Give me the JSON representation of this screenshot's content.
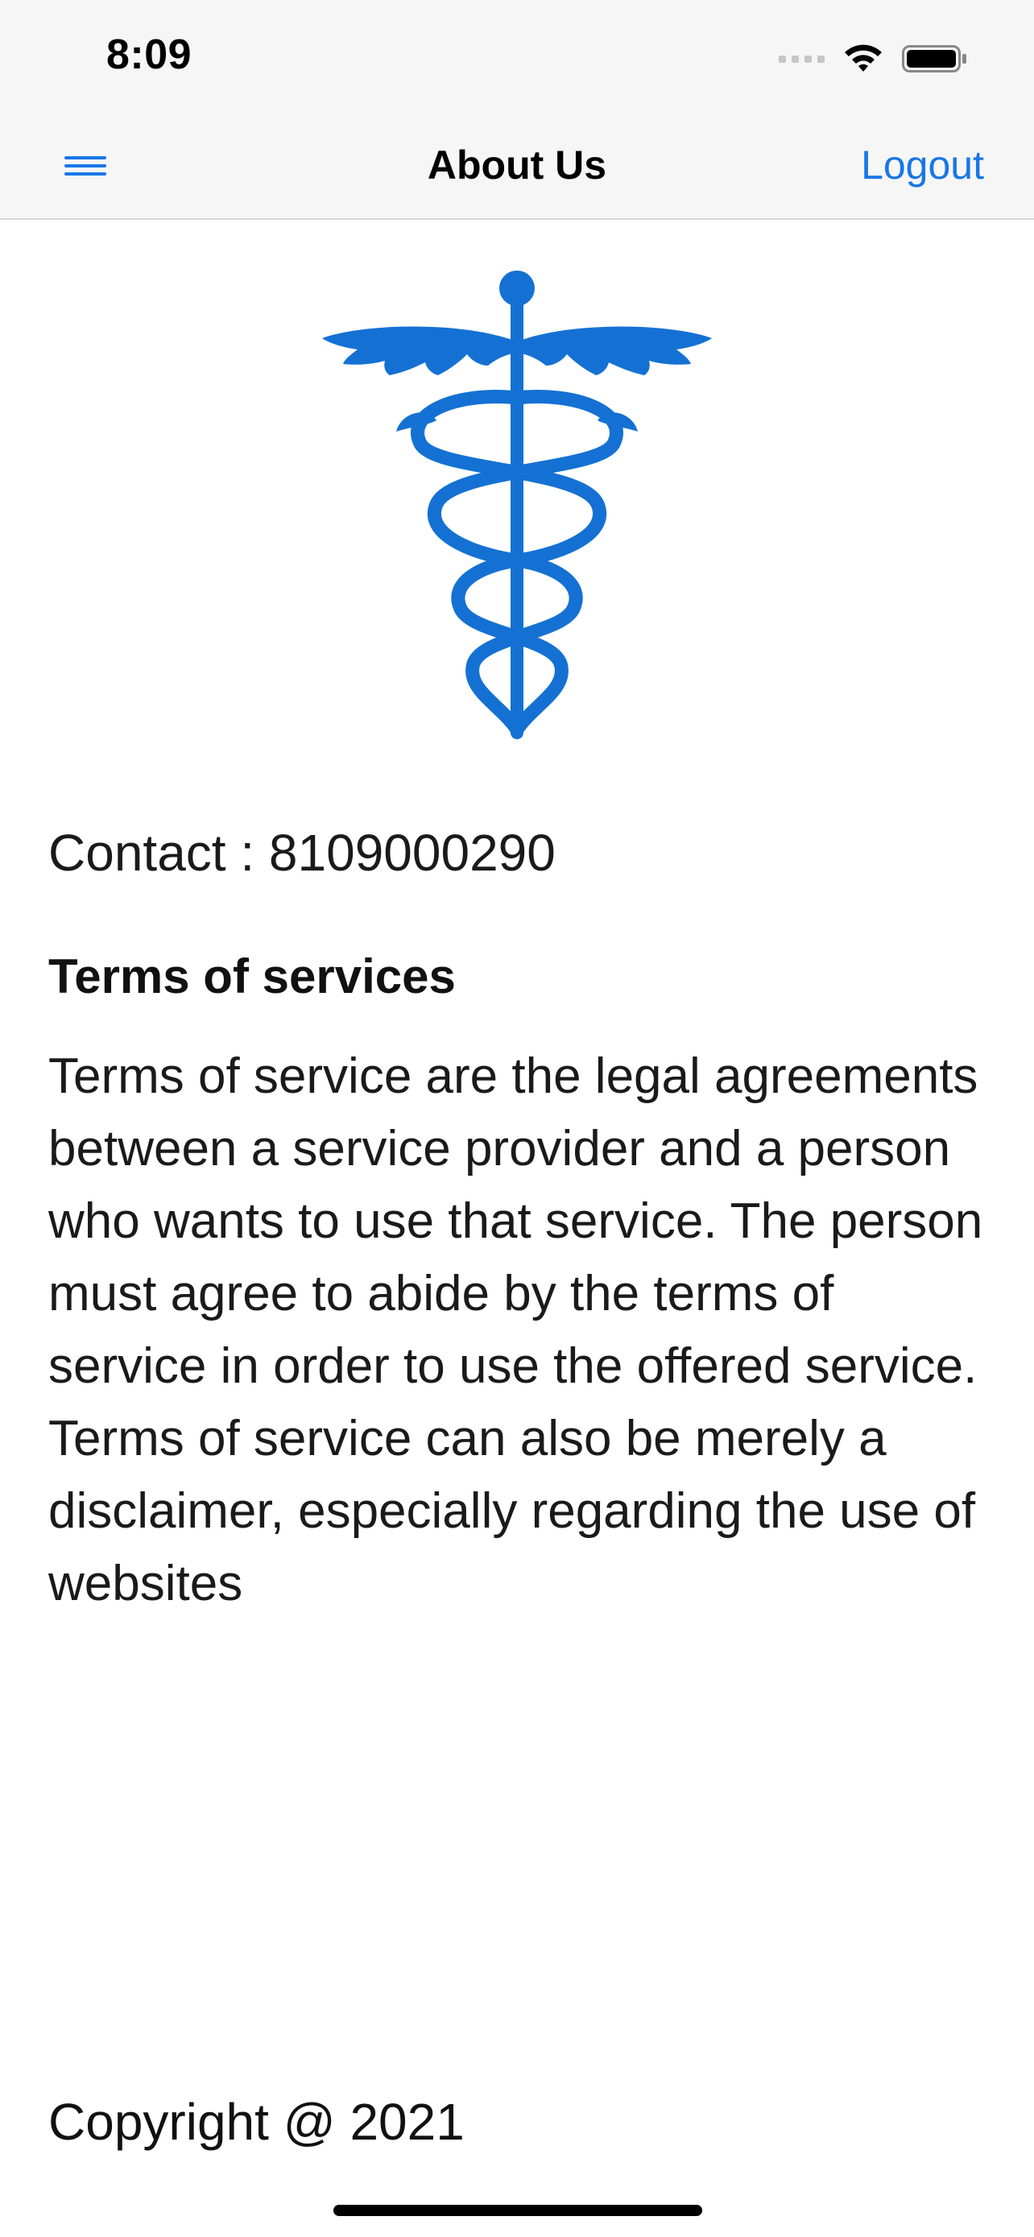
{
  "status_bar": {
    "time": "8:09",
    "icons": [
      "cellular-signal-icon",
      "wifi-icon",
      "battery-icon"
    ]
  },
  "nav_bar": {
    "menu_icon": "hamburger-menu-icon",
    "title": "About Us",
    "logout_label": "Logout"
  },
  "logo": {
    "icon": "caduceus-icon",
    "color": "#1471d3"
  },
  "contact": {
    "text": "Contact : 8109000290"
  },
  "terms": {
    "heading": "Terms of services",
    "body": "Terms of service are the legal agreements between a service provider and a person who wants to use that service. The person must agree to abide by the terms of service in order to use the offered service. Terms of service can also be merely a disclaimer, especially regarding the use of websites"
  },
  "footer": {
    "copyright": "Copyright @ 2021"
  },
  "colors": {
    "accent": "#1877e6",
    "nav_background": "#f6f6f6",
    "text": "#1a1a1a"
  }
}
